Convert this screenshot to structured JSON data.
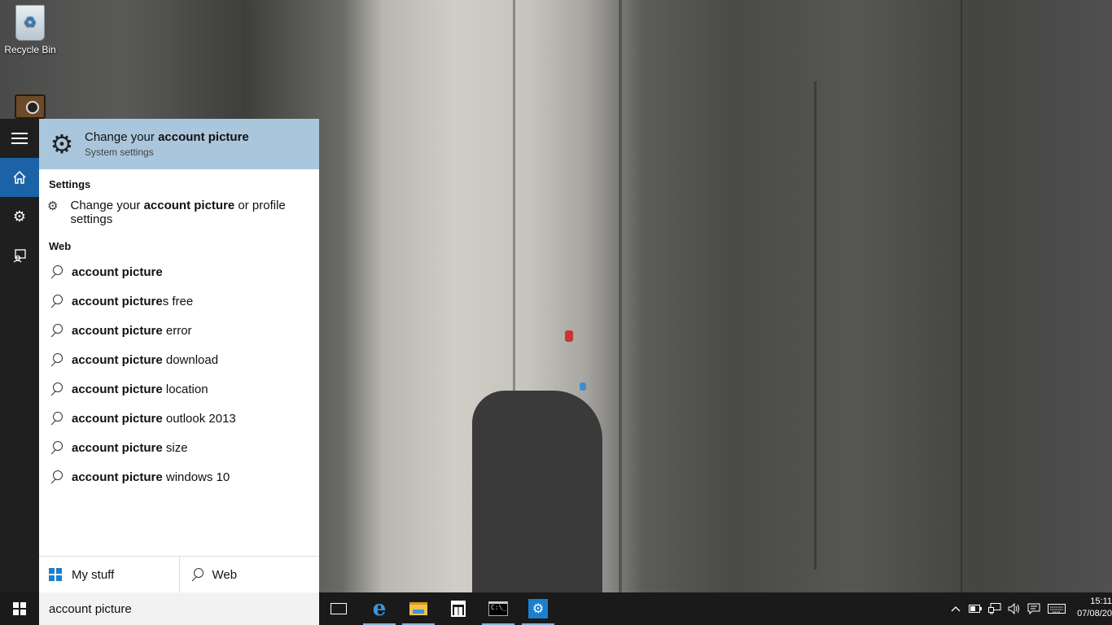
{
  "desktop": {
    "icons": [
      {
        "label": "Recycle Bin",
        "icon": "recycle-bin-icon"
      },
      {
        "label": "",
        "icon": "speaker-icon"
      }
    ]
  },
  "rail": {
    "items": [
      {
        "icon": "hamburger-menu-icon"
      },
      {
        "icon": "home-icon",
        "active": true
      },
      {
        "icon": "gear-icon"
      },
      {
        "icon": "feedback-icon"
      }
    ]
  },
  "search_panel": {
    "best_match": {
      "title_prefix": "Change your ",
      "title_bold": "account picture",
      "subtitle": "System settings",
      "icon": "gear-icon"
    },
    "settings_header": "Settings",
    "settings_items": [
      {
        "prefix": "Change your ",
        "bold": "account picture",
        "suffix": " or profile settings",
        "icon": "gear-icon"
      }
    ],
    "web_header": "Web",
    "web_items": [
      {
        "bold": "account picture",
        "suffix": ""
      },
      {
        "bold": "account picture",
        "suffix": "s free"
      },
      {
        "bold": "account picture",
        "suffix": " error"
      },
      {
        "bold": "account picture",
        "suffix": " download"
      },
      {
        "bold": "account picture",
        "suffix": " location"
      },
      {
        "bold": "account picture",
        "suffix": " outlook 2013"
      },
      {
        "bold": "account picture",
        "suffix": " size"
      },
      {
        "bold": "account picture",
        "suffix": " windows 10"
      }
    ],
    "scopes": [
      {
        "label": "My stuff",
        "icon": "windows-logo-icon"
      },
      {
        "label": "Web",
        "icon": "search-icon"
      }
    ]
  },
  "taskbar": {
    "search_text": "account picture",
    "apps": [
      "task-view-icon",
      "edge-icon",
      "file-explorer-icon",
      "store-icon",
      "command-prompt-icon",
      "settings-app-icon"
    ],
    "tray_icons": [
      "chevron-up-icon",
      "battery-icon",
      "network-icon",
      "volume-icon",
      "action-center-icon",
      "keyboard-icon"
    ],
    "time": "15:11",
    "date": "07/08/20"
  },
  "colors": {
    "accent": "#1b63a6",
    "best_match_bg": "#a9c6dc",
    "taskbar_bg": "#1a1a1a",
    "rail_bg": "#1f1f1f"
  }
}
